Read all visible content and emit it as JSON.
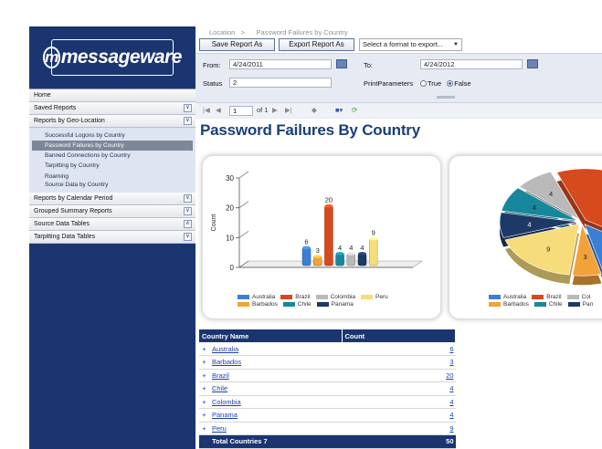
{
  "logo": "messageware",
  "sidebar": {
    "home": "Home",
    "saved_reports": "Saved Reports",
    "geo": "Reports by Geo-Location",
    "geo_items": [
      "Successful Logons by Country",
      "Password Failures by Country",
      "Banned Connections by Country",
      "Tarpitting by Country",
      "Roaming\nSource Data by Country"
    ],
    "calendar": "Reports by Calendar Period",
    "grouped": "Grouped Summary Reports",
    "source": "Source Data Tables",
    "tarpit": "Tarpitting Data Tables"
  },
  "breadcrumb": {
    "root": "Location",
    "sep": ">",
    "current": "Password Failures by Country"
  },
  "toolbar": {
    "save": "Save Report As",
    "export": "Export Report As",
    "format": "Select a format to export..."
  },
  "params": {
    "from_label": "From:",
    "from_value": "4/24/2011",
    "to_label": "To:",
    "to_value": "4/24/2012",
    "status_label": "Status",
    "status_value": "2",
    "print_label": "PrintParameters",
    "opt_true": "True",
    "opt_false": "False"
  },
  "pager": {
    "page": "1",
    "of": "of 1"
  },
  "report_title": "Password Failures By Country",
  "colors": {
    "Australia": "#3a7fd5",
    "Barbados": "#f2a23a",
    "Brazil": "#d64a1e",
    "Chile": "#17879e",
    "Colombia": "#b9b9b9",
    "Panama": "#1d3a66",
    "Peru": "#f6dc7a"
  },
  "chart_data": [
    {
      "type": "bar",
      "categories": [
        "Australia",
        "Barbados",
        "Brazil",
        "Chile",
        "Colombia",
        "Panama",
        "Peru"
      ],
      "values": [
        6,
        3,
        20,
        4,
        4,
        4,
        9
      ],
      "ylabel": "Count",
      "ylim": [
        0,
        30
      ],
      "yticks": [
        "0",
        "10",
        "20",
        "30"
      ],
      "legend": [
        "Australia",
        "Brazil",
        "Colombia",
        "Peru",
        "Barbados",
        "Chile",
        "Panama"
      ]
    },
    {
      "type": "pie",
      "categories": [
        "Australia",
        "Barbados",
        "Brazil",
        "Chile",
        "Colombia",
        "Panama",
        "Peru"
      ],
      "values": [
        6,
        3,
        20,
        4,
        4,
        4,
        9
      ],
      "visible_labels": [
        "20",
        "3",
        "6",
        "4",
        "4"
      ],
      "legend": [
        "Australia",
        "Brazil",
        "Col",
        "Barbados",
        "Chile",
        "Pan"
      ]
    }
  ],
  "table": {
    "headers": [
      "Country Name",
      "Count"
    ],
    "rows": [
      {
        "name": "Australia",
        "count": "6"
      },
      {
        "name": "Barbados",
        "count": "3"
      },
      {
        "name": "Brazil",
        "count": "20"
      },
      {
        "name": "Chile",
        "count": "4"
      },
      {
        "name": "Colombia",
        "count": "4"
      },
      {
        "name": "Panama",
        "count": "4"
      },
      {
        "name": "Peru",
        "count": "9"
      }
    ],
    "total_label": "Total Countries 7",
    "total_value": "50"
  }
}
